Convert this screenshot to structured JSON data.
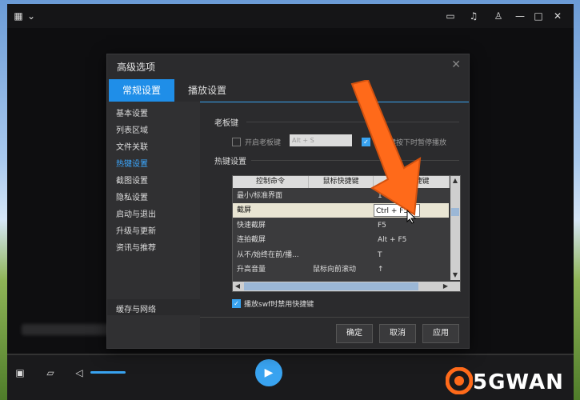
{
  "dialog": {
    "title": "高级选项",
    "tabs": [
      "常规设置",
      "播放设置"
    ],
    "sidebar": [
      {
        "label": "基本设置"
      },
      {
        "label": "列表区域"
      },
      {
        "label": "文件关联"
      },
      {
        "label": "热键设置",
        "active": true
      },
      {
        "label": "截图设置"
      },
      {
        "label": "隐私设置"
      },
      {
        "label": "启动与退出"
      },
      {
        "label": "升级与更新"
      },
      {
        "label": "资讯与推荐"
      }
    ],
    "sidebar_bottom": "缓存与网络",
    "boss_key": {
      "section": "老板键",
      "enable_label": "开启老板键",
      "value": "Alt + S",
      "pause_label": "键按下时暂停播放"
    },
    "hotkeys": {
      "section": "热键设置",
      "columns": [
        "控制命令",
        "鼠标快捷键",
        "键盘快捷键"
      ],
      "rows": [
        {
          "cmd": "最小/标准界面",
          "mouse": "",
          "key": "1"
        },
        {
          "cmd": "截屏",
          "mouse": "",
          "key": "Ctrl + F5",
          "selected": true
        },
        {
          "cmd": "快速截屏",
          "mouse": "",
          "key": "F5"
        },
        {
          "cmd": "连拍截屏",
          "mouse": "",
          "key": "Alt + F5"
        },
        {
          "cmd": "从不/始终在前/播...",
          "mouse": "",
          "key": "T"
        },
        {
          "cmd": "升高音量",
          "mouse": "鼠标向前滚动",
          "key": "↑"
        }
      ]
    },
    "swf_label": "播放swf时禁用快捷键",
    "buttons": {
      "ok": "确定",
      "cancel": "取消",
      "apply": "应用"
    }
  },
  "watermark": "5GWAN",
  "colors": {
    "accent": "#1f8ee8",
    "arrow": "#ff6a1a"
  }
}
